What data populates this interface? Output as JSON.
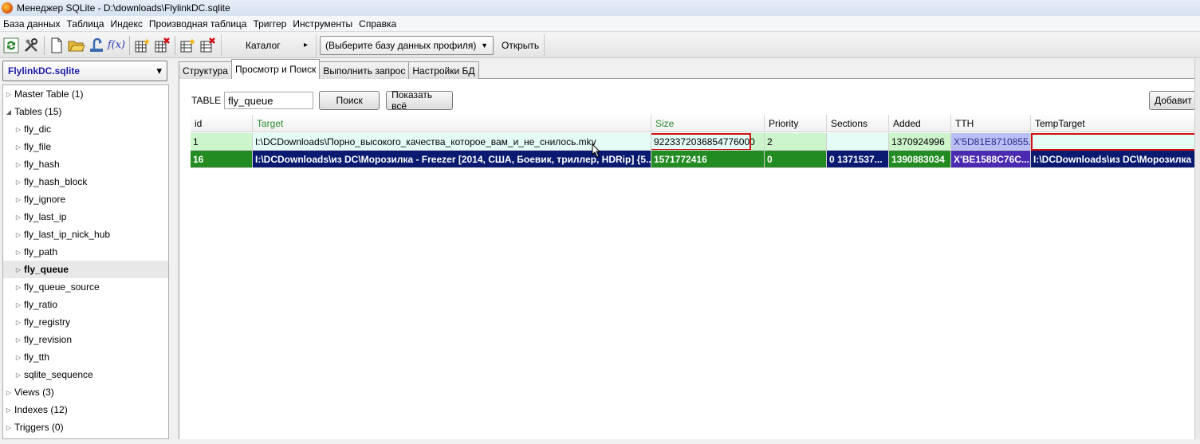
{
  "window": {
    "title": "Менеджер SQLite - D:\\downloads\\FlylinkDC.sqlite"
  },
  "menu": [
    {
      "label": "База данных"
    },
    {
      "label": "Таблица"
    },
    {
      "label": "Индекс"
    },
    {
      "label": "Производная таблица"
    },
    {
      "label": "Триггер"
    },
    {
      "label": "Инструменты"
    },
    {
      "label": "Справка"
    }
  ],
  "toolbar": {
    "fx_label": "f(x)",
    "catalog_label": "Каталог",
    "catalog_arrow": "▸",
    "profile_select_value": "(Выберите базу данных профиля)",
    "open_label": "Открыть",
    "icons": [
      "refresh-icon",
      "tools-icon",
      "new-file-icon",
      "open-folder-icon",
      "connect-icon",
      "function-icon",
      "create-table-icon",
      "drop-table-icon",
      "create-index-icon",
      "drop-index-icon"
    ]
  },
  "db_selector": {
    "value": "FlylinkDC.sqlite",
    "arrow": "▾"
  },
  "tree": {
    "master": "Master Table (1)",
    "tables_label": "Tables (15)",
    "tables": [
      "fly_dic",
      "fly_file",
      "fly_hash",
      "fly_hash_block",
      "fly_ignore",
      "fly_last_ip",
      "fly_last_ip_nick_hub",
      "fly_path",
      "fly_queue",
      "fly_queue_source",
      "fly_ratio",
      "fly_registry",
      "fly_revision",
      "fly_tth",
      "sqlite_sequence"
    ],
    "selected": "fly_queue",
    "views": "Views (3)",
    "indexes": "Indexes (12)",
    "triggers": "Triggers (0)"
  },
  "tabs": [
    {
      "label": "Структура"
    },
    {
      "label": "Просмотр и Поиск"
    },
    {
      "label": "Выполнить запрос"
    },
    {
      "label": "Настройки БД"
    }
  ],
  "search": {
    "table_label": "TABLE",
    "table_value": "fly_queue",
    "search_button": "Поиск",
    "show_all_button": "Показать всё",
    "add_button": "Добавит"
  },
  "grid": {
    "columns": [
      "id",
      "Target",
      "Size",
      "Priority",
      "Sections",
      "Added",
      "TTH",
      "TempTarget"
    ],
    "rows": [
      [
        "1",
        "I:\\DCDownloads\\Порно_высокого_качества_которое_вам_и_не_снилось.mkv",
        "9223372036854776000",
        "2",
        "",
        "1370924996",
        "X'5D81E8710855...",
        ""
      ],
      [
        "16",
        "I:\\DCDownloads\\из DC\\Морозилка - Freezer [2014, США, Боевик, триллер, HDRip] {5...",
        "1571772416",
        "0",
        "0 1371537...",
        "1390883034",
        "X'BE1588C76C...",
        "I:\\DCDownloads\\из DC\\Морозилка -"
      ]
    ]
  },
  "colors": {
    "row1": "#ccf5cc",
    "row2": "#228b22",
    "highlight_navy": "#0a1a70",
    "annotation_red": "#d01010"
  }
}
